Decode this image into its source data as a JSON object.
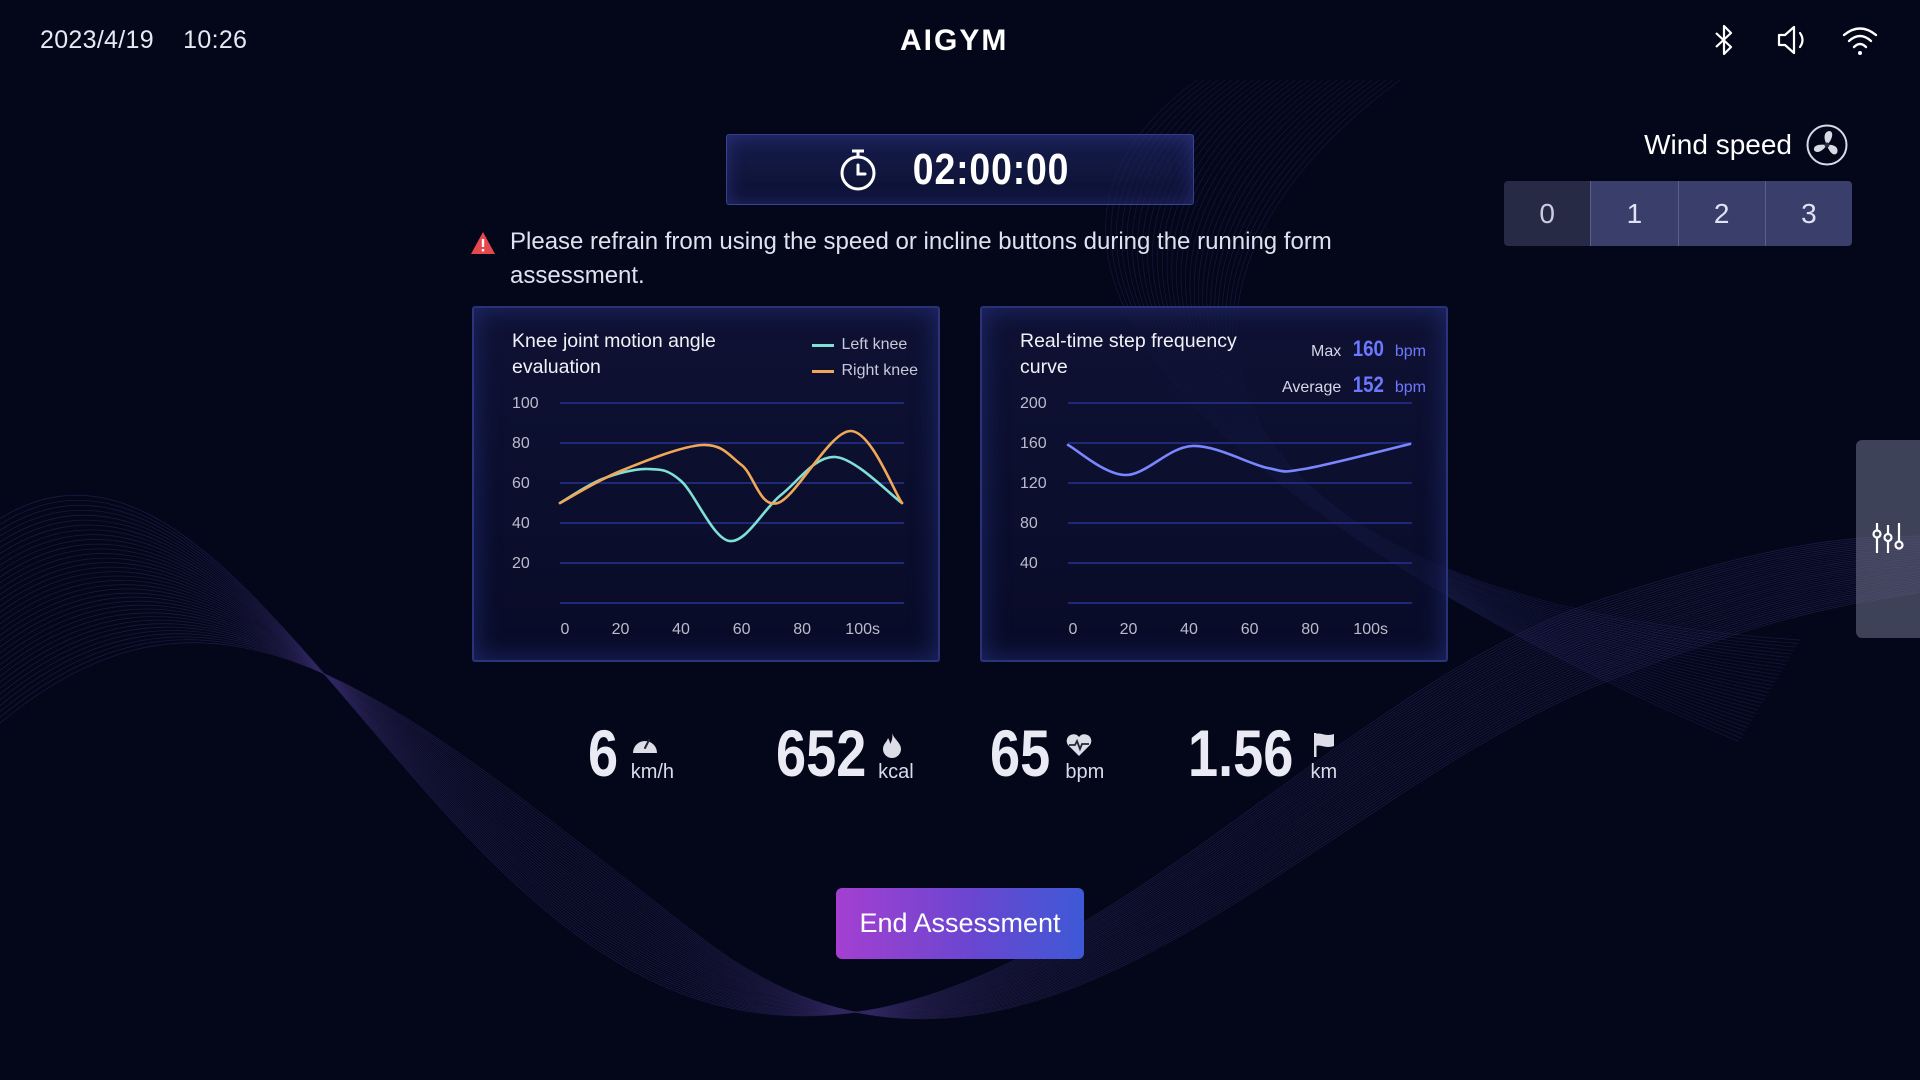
{
  "status_bar": {
    "date": "2023/4/19",
    "time": "10:26",
    "logo": "AIGYM",
    "icons": [
      "bluetooth-icon",
      "volume-icon",
      "wifi-icon"
    ]
  },
  "timer": {
    "icon": "stopwatch-icon",
    "value": "02:00:00"
  },
  "wind_speed": {
    "label": "Wind speed",
    "icon": "fan-icon",
    "options": [
      "0",
      "1",
      "2",
      "3"
    ],
    "selected": "0"
  },
  "warning": {
    "icon": "warning-triangle-icon",
    "text": "Please refrain from using the speed or incline buttons during the running form assessment.",
    "color": "#e5484d"
  },
  "chart_data": [
    {
      "type": "line",
      "title": "Knee joint motion angle evaluation",
      "xlabel": "",
      "ylabel": "",
      "x_ticks": [
        "0",
        "20",
        "40",
        "60",
        "80",
        "100s"
      ],
      "y_ticks": [
        "100",
        "80",
        "60",
        "40",
        "20"
      ],
      "xlim": [
        0,
        113
      ],
      "ylim": [
        0,
        100
      ],
      "grid": true,
      "legend_position": "top-right",
      "series": [
        {
          "name": "Left knee",
          "color": "#7fe0d6",
          "x": [
            0,
            14,
            29,
            40,
            56,
            73,
            91,
            113
          ],
          "values": [
            50,
            62,
            67,
            61,
            31,
            54,
            73,
            50
          ]
        },
        {
          "name": "Right knee",
          "color": "#f0a858",
          "x": [
            0,
            20,
            47,
            60,
            72,
            96,
            113
          ],
          "values": [
            50,
            66,
            79,
            69,
            50,
            86,
            50
          ]
        }
      ]
    },
    {
      "type": "line",
      "title": "Real-time step frequency curve",
      "xlabel": "",
      "ylabel": "",
      "x_ticks": [
        "0",
        "20",
        "40",
        "60",
        "80",
        "100s"
      ],
      "y_ticks": [
        "200",
        "160",
        "120",
        "80",
        "40"
      ],
      "xlim": [
        0,
        113
      ],
      "ylim": [
        0,
        200
      ],
      "grid": true,
      "stats": {
        "max_label": "Max",
        "max_value": "160",
        "average_label": "Average",
        "average_value": "152",
        "unit": "bpm"
      },
      "series": [
        {
          "name": "Step frequency",
          "color": "#7a86ff",
          "x": [
            0,
            19,
            41,
            66,
            78,
            113
          ],
          "values": [
            158,
            128,
            157,
            135,
            134,
            159
          ]
        }
      ]
    }
  ],
  "metrics": [
    {
      "value": "6",
      "unit": "km/h",
      "icon": "speedometer-icon"
    },
    {
      "value": "652",
      "unit": "kcal",
      "icon": "flame-icon"
    },
    {
      "value": "65",
      "unit": "bpm",
      "icon": "heart-rate-icon"
    },
    {
      "value": "1.56",
      "unit": "km",
      "icon": "flag-icon"
    }
  ],
  "end_button": {
    "label": "End Assessment"
  },
  "side_panel": {
    "icon": "sliders-icon"
  }
}
